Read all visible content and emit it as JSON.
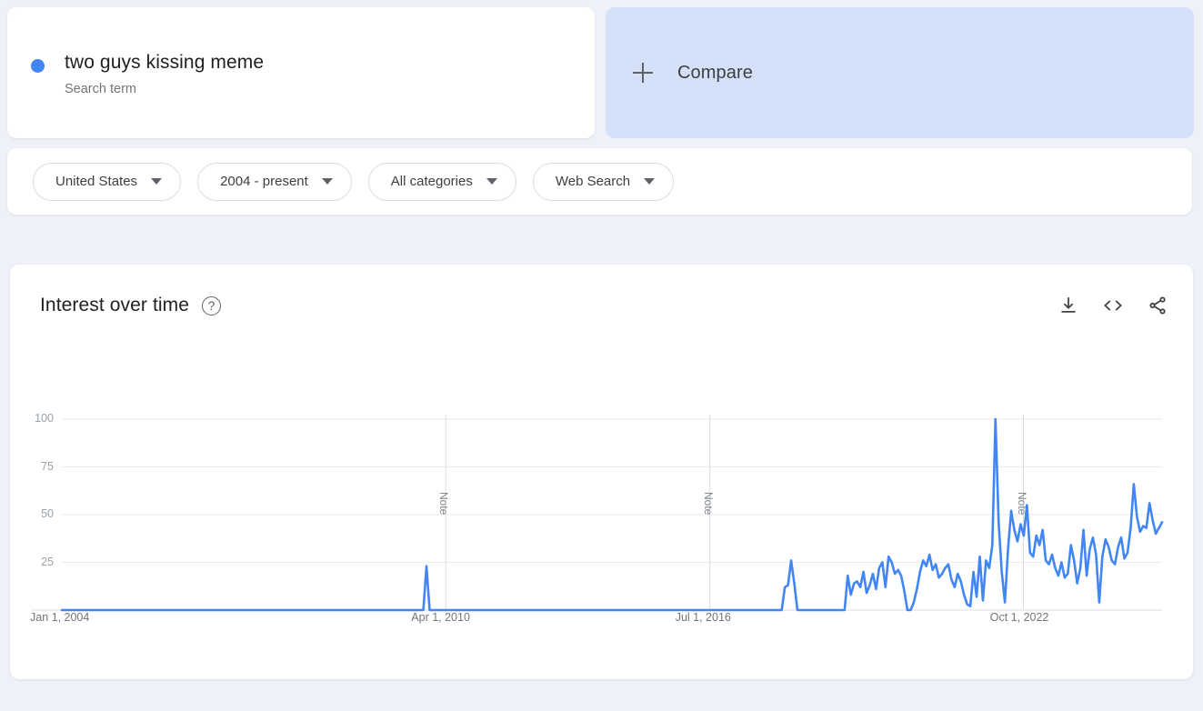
{
  "search_term": {
    "title": "two guys kissing meme",
    "subtitle": "Search term",
    "dot_color": "#4285f4"
  },
  "compare": {
    "label": "Compare",
    "icon": "plus-icon",
    "background": "#d3e0f7"
  },
  "filters": [
    {
      "label": "United States",
      "name": "region"
    },
    {
      "label": "2004 - present",
      "name": "time-range"
    },
    {
      "label": "All categories",
      "name": "category"
    },
    {
      "label": "Web Search",
      "name": "search-type"
    }
  ],
  "interest_over_time": {
    "title": "Interest over time",
    "help_icon": "help-circle-icon",
    "actions": [
      {
        "name": "download-csv-button",
        "icon": "download-icon"
      },
      {
        "name": "embed-button",
        "icon": "code-embed-icon"
      },
      {
        "name": "share-button",
        "icon": "share-icon"
      }
    ]
  },
  "chart_data": {
    "type": "line",
    "title": "Interest over time",
    "xlabel": "",
    "ylabel": "",
    "ylim": [
      0,
      100
    ],
    "yticks": [
      25,
      50,
      75,
      100
    ],
    "grid": true,
    "legend": false,
    "line_color": "#4285f4",
    "xticks": [
      "Jan 1, 2004",
      "Apr 1, 2010",
      "Jul 1, 2016",
      "Oct 1, 2022"
    ],
    "xtick_positions": [
      0,
      0.349,
      0.589,
      0.875
    ],
    "annotations": [
      {
        "label": "Note",
        "position": 0.349
      },
      {
        "label": "Note",
        "position": 0.589
      },
      {
        "label": "Note",
        "position": 0.874
      }
    ],
    "x_start": "Jan 1, 2004",
    "x_end": "Nov 1, 2024",
    "series": [
      {
        "name": "two guys kissing meme",
        "color": "#4285f4",
        "values": [
          0,
          0,
          0,
          0,
          0,
          0,
          0,
          0,
          0,
          0,
          0,
          0,
          0,
          0,
          0,
          0,
          0,
          0,
          0,
          0,
          0,
          0,
          0,
          0,
          0,
          0,
          0,
          0,
          0,
          0,
          0,
          0,
          0,
          0,
          0,
          0,
          0,
          0,
          0,
          0,
          0,
          0,
          0,
          0,
          0,
          0,
          0,
          0,
          0,
          0,
          0,
          0,
          0,
          0,
          0,
          0,
          0,
          0,
          0,
          0,
          0,
          0,
          0,
          0,
          0,
          0,
          0,
          0,
          0,
          0,
          0,
          0,
          0,
          0,
          0,
          0,
          0,
          0,
          0,
          0,
          0,
          0,
          0,
          0,
          0,
          0,
          0,
          0,
          0,
          0,
          0,
          0,
          0,
          0,
          0,
          0,
          0,
          0,
          0,
          0,
          0,
          0,
          0,
          0,
          0,
          0,
          0,
          0,
          0,
          0,
          0,
          0,
          0,
          0,
          0,
          0,
          23,
          0,
          0,
          0,
          0,
          0,
          0,
          0,
          0,
          0,
          0,
          0,
          0,
          0,
          0,
          0,
          0,
          0,
          0,
          0,
          0,
          0,
          0,
          0,
          0,
          0,
          0,
          0,
          0,
          0,
          0,
          0,
          0,
          0,
          0,
          0,
          0,
          0,
          0,
          0,
          0,
          0,
          0,
          0,
          0,
          0,
          0,
          0,
          0,
          0,
          0,
          0,
          0,
          0,
          0,
          0,
          0,
          0,
          0,
          0,
          0,
          0,
          0,
          0,
          0,
          0,
          0,
          0,
          0,
          0,
          0,
          0,
          0,
          0,
          0,
          0,
          0,
          0,
          0,
          0,
          0,
          0,
          0,
          0,
          0,
          0,
          0,
          0,
          0,
          0,
          0,
          0,
          0,
          0,
          0,
          0,
          0,
          0,
          0,
          0,
          0,
          0,
          0,
          0,
          0,
          0,
          0,
          0,
          0,
          0,
          0,
          0,
          0,
          0,
          12,
          13,
          26,
          14,
          0,
          0,
          0,
          0,
          0,
          0,
          0,
          0,
          0,
          0,
          0,
          0,
          0,
          0,
          0,
          0,
          18,
          8,
          14,
          15,
          12,
          20,
          9,
          13,
          19,
          11,
          22,
          25,
          12,
          28,
          25,
          19,
          21,
          18,
          10,
          0,
          0,
          4,
          11,
          20,
          26,
          23,
          29,
          21,
          24,
          17,
          19,
          22,
          24,
          16,
          12,
          19,
          15,
          8,
          3,
          2,
          20,
          7,
          28,
          5,
          26,
          22,
          34,
          100,
          46,
          20,
          4,
          32,
          52,
          42,
          36,
          45,
          39,
          55,
          30,
          28,
          39,
          34,
          42,
          26,
          24,
          29,
          22,
          18,
          25,
          17,
          19,
          34,
          26,
          14,
          22,
          42,
          18,
          32,
          38,
          29,
          4,
          28,
          37,
          33,
          26,
          24,
          33,
          38,
          27,
          30,
          43,
          66,
          49,
          41,
          44,
          43,
          56,
          47,
          40,
          43,
          46
        ]
      }
    ]
  }
}
